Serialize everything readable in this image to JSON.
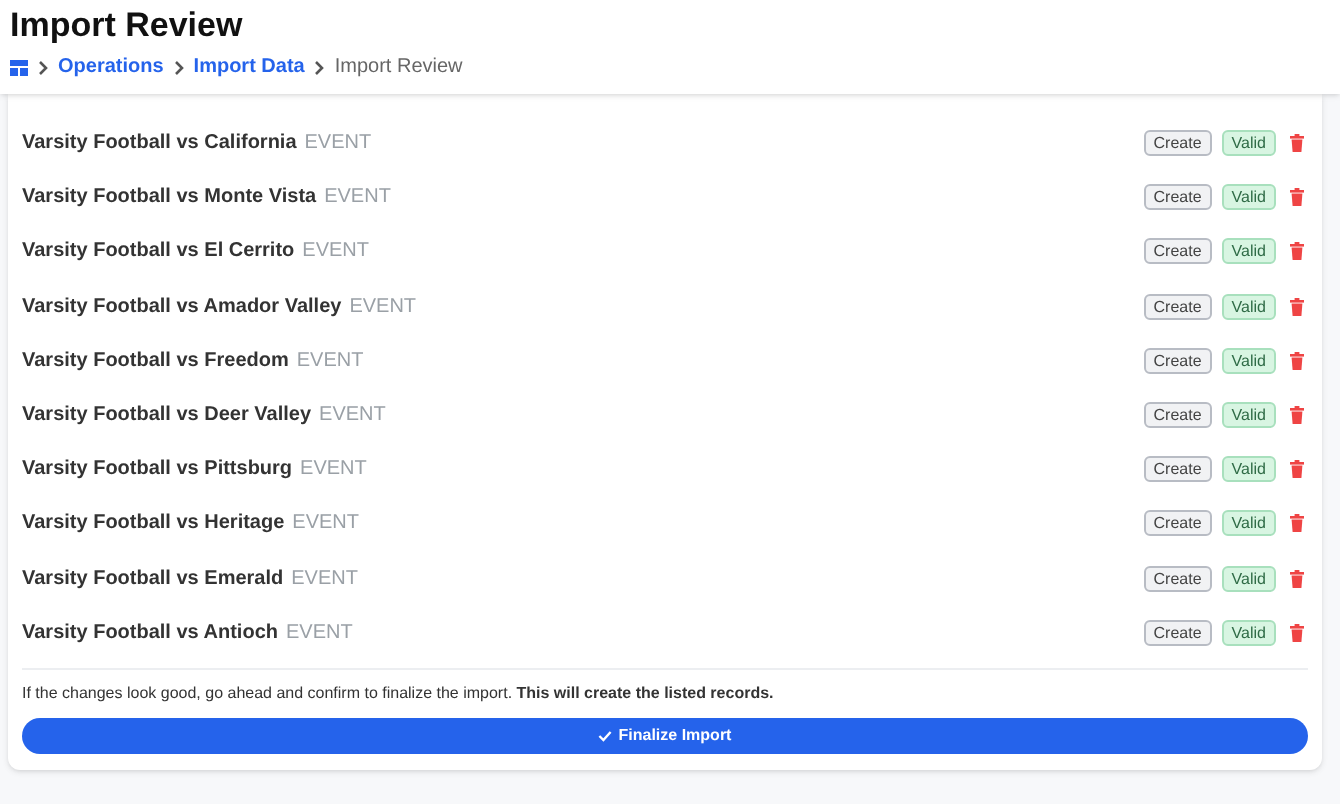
{
  "title": "Import Review",
  "breadcrumb": [
    {
      "label": "Operations",
      "kind": "link"
    },
    {
      "label": "Import Data",
      "kind": "link"
    },
    {
      "label": "Import Review",
      "kind": "current"
    }
  ],
  "rows": [
    {
      "name": "Varsity Football vs California",
      "type": "EVENT",
      "action": "Create",
      "status": "Valid"
    },
    {
      "name": "Varsity Football vs Monte Vista",
      "type": "EVENT",
      "action": "Create",
      "status": "Valid"
    },
    {
      "name": "Varsity Football vs El Cerrito",
      "type": "EVENT",
      "action": "Create",
      "status": "Valid"
    },
    {
      "name": "Varsity Football vs Amador Valley",
      "type": "EVENT",
      "action": "Create",
      "status": "Valid"
    },
    {
      "name": "Varsity Football vs Freedom",
      "type": "EVENT",
      "action": "Create",
      "status": "Valid"
    },
    {
      "name": "Varsity Football vs Deer Valley",
      "type": "EVENT",
      "action": "Create",
      "status": "Valid"
    },
    {
      "name": "Varsity Football vs Pittsburg",
      "type": "EVENT",
      "action": "Create",
      "status": "Valid"
    },
    {
      "name": "Varsity Football vs Heritage",
      "type": "EVENT",
      "action": "Create",
      "status": "Valid"
    },
    {
      "name": "Varsity Football vs Emerald",
      "type": "EVENT",
      "action": "Create",
      "status": "Valid"
    },
    {
      "name": "Varsity Football vs Antioch",
      "type": "EVENT",
      "action": "Create",
      "status": "Valid"
    }
  ],
  "confirm_text": "If the changes look good, go ahead and confirm to finalize the import. **This will create the listed records.**",
  "finalize_button": "Finalize Import"
}
